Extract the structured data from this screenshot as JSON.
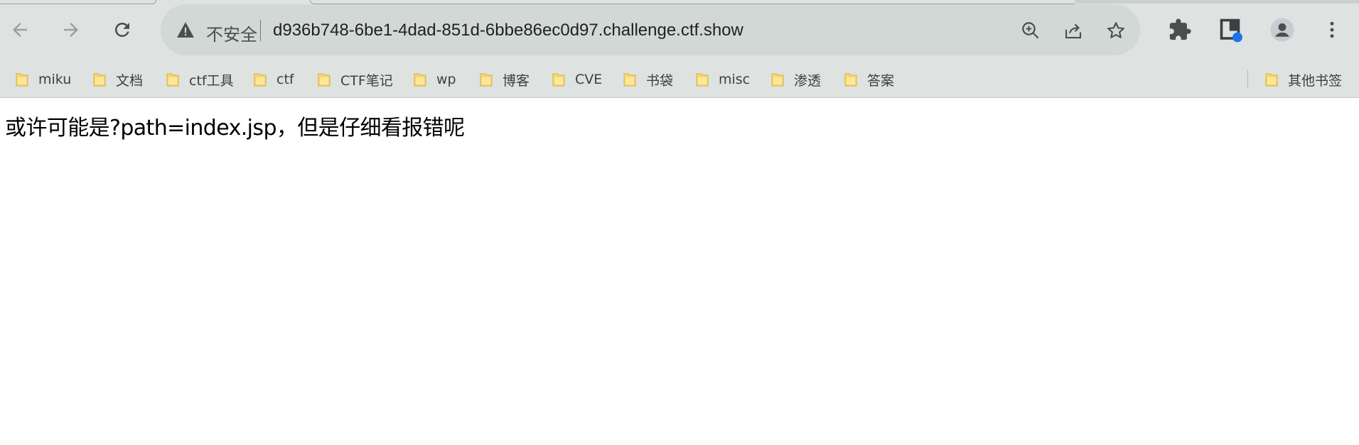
{
  "browser": {
    "security_label": "不安全",
    "url": "d936b748-6be1-4dad-851d-6bbe86ec0d97.challenge.ctf.show",
    "icons": {
      "back": "arrow-left-icon",
      "forward": "arrow-right-icon",
      "reload": "reload-icon",
      "warning": "warning-triangle-icon",
      "zoom": "zoom-in-icon",
      "share": "share-icon",
      "bookmark": "star-icon",
      "extensions": "puzzle-icon",
      "profile_ext": "extension-badge-icon",
      "profile": "profile-avatar-icon",
      "menu": "kebab-menu-icon"
    },
    "colors": {
      "toolbar": "#dee3e1",
      "omnibox": "#d2d8d5",
      "folder": "#f6d86b",
      "badge": "#1a73e8"
    }
  },
  "bookmarks": {
    "items": [
      {
        "label": "miku"
      },
      {
        "label": "文档"
      },
      {
        "label": "ctf工具"
      },
      {
        "label": "ctf"
      },
      {
        "label": "CTF笔记"
      },
      {
        "label": "wp"
      },
      {
        "label": "博客"
      },
      {
        "label": "CVE"
      },
      {
        "label": "书袋"
      },
      {
        "label": "misc"
      },
      {
        "label": "渗透"
      },
      {
        "label": "答案"
      }
    ],
    "other_bookmarks": "其他书签"
  },
  "page": {
    "text": "或许可能是?path=index.jsp，但是仔细看报错呢"
  }
}
